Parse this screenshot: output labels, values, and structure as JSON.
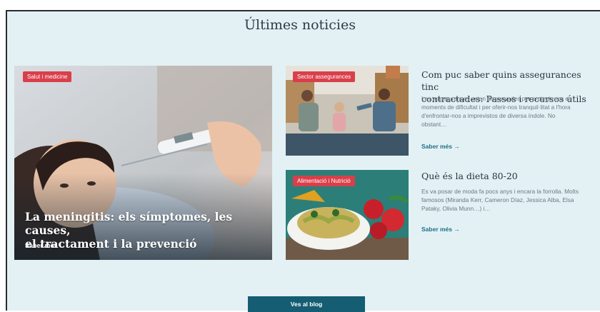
{
  "section": {
    "title": "Últimes noticies"
  },
  "featured": {
    "badge": "Salut i medicine",
    "title_line1": "La meningitis: els símptomes, les causes,",
    "title_line2": "el tractament i la prevenció",
    "link": "Saber més →"
  },
  "articles": [
    {
      "badge": "Sector assegurances",
      "title_line1": "Com puc saber quins assegurances tinc",
      "title_line2": "contractades: Passos i recursos útils",
      "excerpt_lines": [
        "Les assegurances estan dissenyades per protegir-nos en",
        "moments de dificultat i per oferir-nos tranquil·litat a l'hora",
        "d'enfrontar-nos a imprevistos de diversa índole. No",
        "obstant…"
      ],
      "link": "Saber més →"
    },
    {
      "badge": "Alimentació i Nutrició",
      "title_line1": "Què és la dieta 80-20",
      "excerpt_lines": [
        "Es va posar de moda fa pocs anys i encara la forrolla. Molts",
        "famosos (Miranda Kerr, Cameron Díaz, Jessica Alba, Elsa",
        "Pataky, Olivia Munn…) i…"
      ],
      "link": "Saber més →"
    }
  ],
  "blog_button": "Ves al blog",
  "colors": {
    "background": "#e3f1f5",
    "badge": "#d93f4a",
    "button": "#155d72",
    "link": "#1d6f86"
  }
}
